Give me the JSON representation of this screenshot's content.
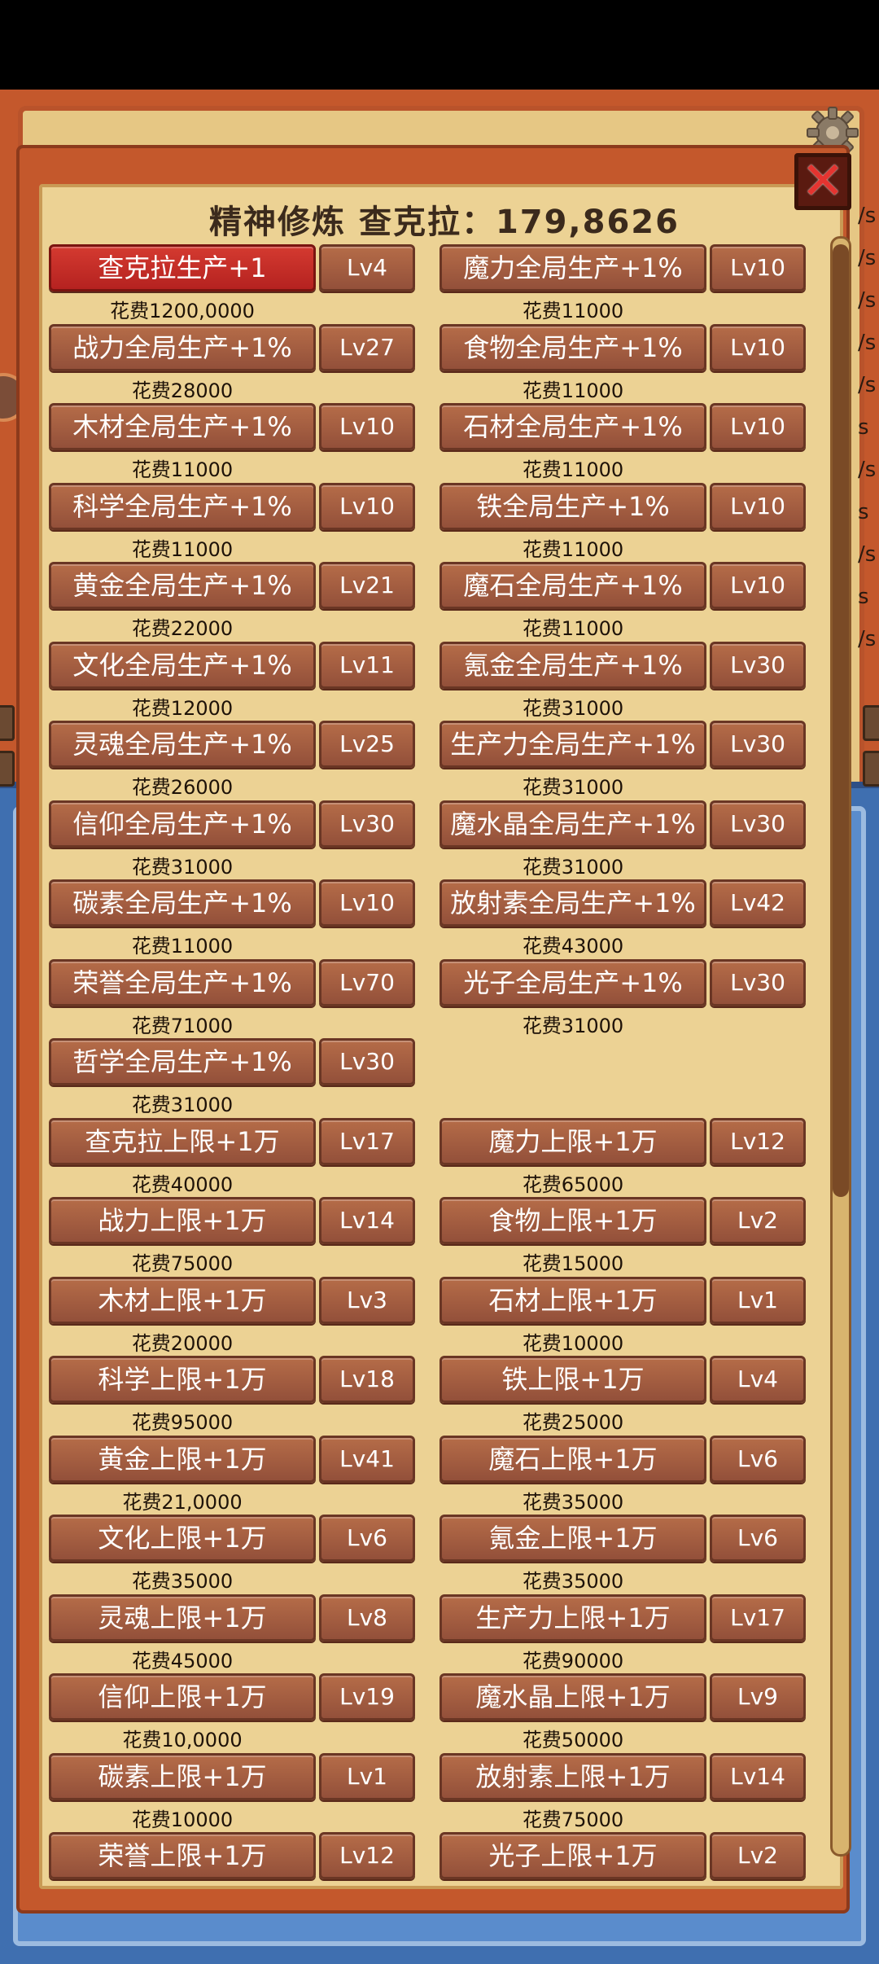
{
  "title": "精神修炼 查克拉：179,8626",
  "close_icon": "close-icon",
  "gear_icon": "gear-icon",
  "edge_fragments": [
    "/s",
    "/s",
    "/s",
    "/s",
    "/s",
    "s",
    "/s",
    "s",
    "/s",
    "s",
    "/s"
  ],
  "left_items": [
    {
      "name": "查克拉生产+1",
      "level": "Lv4",
      "cost": "花费1200,0000",
      "active": true
    },
    {
      "name": "战力全局生产+1%",
      "level": "Lv27",
      "cost": "花费28000"
    },
    {
      "name": "木材全局生产+1%",
      "level": "Lv10",
      "cost": "花费11000"
    },
    {
      "name": "科学全局生产+1%",
      "level": "Lv10",
      "cost": "花费11000"
    },
    {
      "name": "黄金全局生产+1%",
      "level": "Lv21",
      "cost": "花费22000"
    },
    {
      "name": "文化全局生产+1%",
      "level": "Lv11",
      "cost": "花费12000"
    },
    {
      "name": "灵魂全局生产+1%",
      "level": "Lv25",
      "cost": "花费26000"
    },
    {
      "name": "信仰全局生产+1%",
      "level": "Lv30",
      "cost": "花费31000"
    },
    {
      "name": "碳素全局生产+1%",
      "level": "Lv10",
      "cost": "花费11000"
    },
    {
      "name": "荣誉全局生产+1%",
      "level": "Lv70",
      "cost": "花费71000"
    },
    {
      "name": "哲学全局生产+1%",
      "level": "Lv30",
      "cost": "花费31000"
    },
    {
      "name": "查克拉上限+1万",
      "level": "Lv17",
      "cost": "花费40000"
    },
    {
      "name": "战力上限+1万",
      "level": "Lv14",
      "cost": "花费75000"
    },
    {
      "name": "木材上限+1万",
      "level": "Lv3",
      "cost": "花费20000"
    },
    {
      "name": "科学上限+1万",
      "level": "Lv18",
      "cost": "花费95000"
    },
    {
      "name": "黄金上限+1万",
      "level": "Lv41",
      "cost": "花费21,0000"
    },
    {
      "name": "文化上限+1万",
      "level": "Lv6",
      "cost": "花费35000"
    },
    {
      "name": "灵魂上限+1万",
      "level": "Lv8",
      "cost": "花费45000"
    },
    {
      "name": "信仰上限+1万",
      "level": "Lv19",
      "cost": "花费10,0000"
    },
    {
      "name": "碳素上限+1万",
      "level": "Lv1",
      "cost": "花费10000"
    },
    {
      "name": "荣誉上限+1万",
      "level": "Lv12",
      "cost": ""
    }
  ],
  "right_items": [
    {
      "name": "魔力全局生产+1%",
      "level": "Lv10",
      "cost": "花费11000"
    },
    {
      "name": "食物全局生产+1%",
      "level": "Lv10",
      "cost": "花费11000"
    },
    {
      "name": "石材全局生产+1%",
      "level": "Lv10",
      "cost": "花费11000"
    },
    {
      "name": "铁全局生产+1%",
      "level": "Lv10",
      "cost": "花费11000"
    },
    {
      "name": "魔石全局生产+1%",
      "level": "Lv10",
      "cost": "花费11000"
    },
    {
      "name": "氪金全局生产+1%",
      "level": "Lv30",
      "cost": "花费31000"
    },
    {
      "name": "生产力全局生产+1%",
      "level": "Lv30",
      "cost": "花费31000"
    },
    {
      "name": "魔水晶全局生产+1%",
      "level": "Lv30",
      "cost": "花费31000"
    },
    {
      "name": "放射素全局生产+1%",
      "level": "Lv42",
      "cost": "花费43000"
    },
    {
      "name": "光子全局生产+1%",
      "level": "Lv30",
      "cost": "花费31000"
    },
    null,
    {
      "name": "魔力上限+1万",
      "level": "Lv12",
      "cost": "花费65000"
    },
    {
      "name": "食物上限+1万",
      "level": "Lv2",
      "cost": "花费15000"
    },
    {
      "name": "石材上限+1万",
      "level": "Lv1",
      "cost": "花费10000"
    },
    {
      "name": "铁上限+1万",
      "level": "Lv4",
      "cost": "花费25000"
    },
    {
      "name": "魔石上限+1万",
      "level": "Lv6",
      "cost": "花费35000"
    },
    {
      "name": "氪金上限+1万",
      "level": "Lv6",
      "cost": "花费35000"
    },
    {
      "name": "生产力上限+1万",
      "level": "Lv17",
      "cost": "花费90000"
    },
    {
      "name": "魔水晶上限+1万",
      "level": "Lv9",
      "cost": "花费50000"
    },
    {
      "name": "放射素上限+1万",
      "level": "Lv14",
      "cost": "花费75000"
    },
    {
      "name": "光子上限+1万",
      "level": "Lv2",
      "cost": ""
    }
  ]
}
